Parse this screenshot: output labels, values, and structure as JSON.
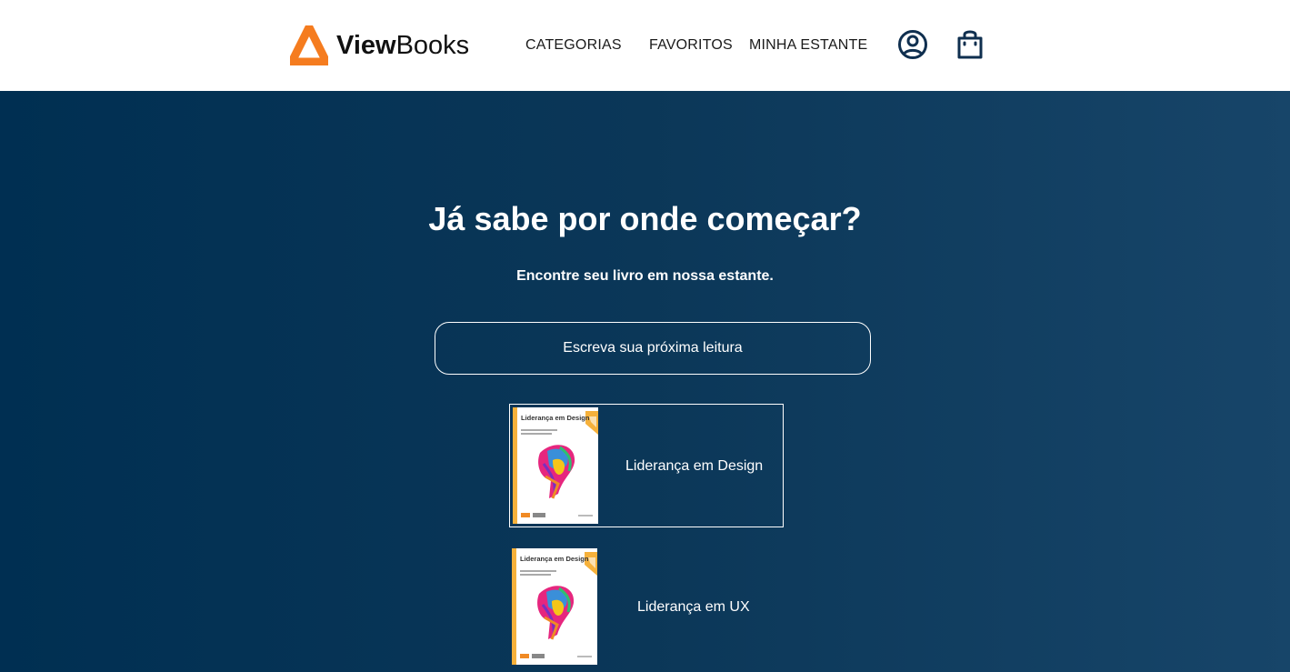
{
  "brand": {
    "name_bold": "View",
    "name_regular": "Books",
    "accent_color": "#f57c1f"
  },
  "nav": {
    "items": [
      {
        "label": "CATEGORIAS"
      },
      {
        "label": "FAVORITOS"
      },
      {
        "label": "MINHA ESTANTE"
      }
    ],
    "icons": [
      "profile-icon",
      "shopping-bag-icon"
    ]
  },
  "hero": {
    "title": "Já sabe por onde começar?",
    "subtitle": "Encontre seu livro em nossa estante.",
    "background_start": "#002f52",
    "background_end": "#174569"
  },
  "search": {
    "placeholder": "Escreva sua próxima leitura",
    "value": ""
  },
  "results": [
    {
      "title": "Liderança em Design",
      "cover_title": "Liderança em Design",
      "selected": true
    },
    {
      "title": "Liderança em UX",
      "cover_title": "Liderança em Design",
      "selected": false
    }
  ]
}
